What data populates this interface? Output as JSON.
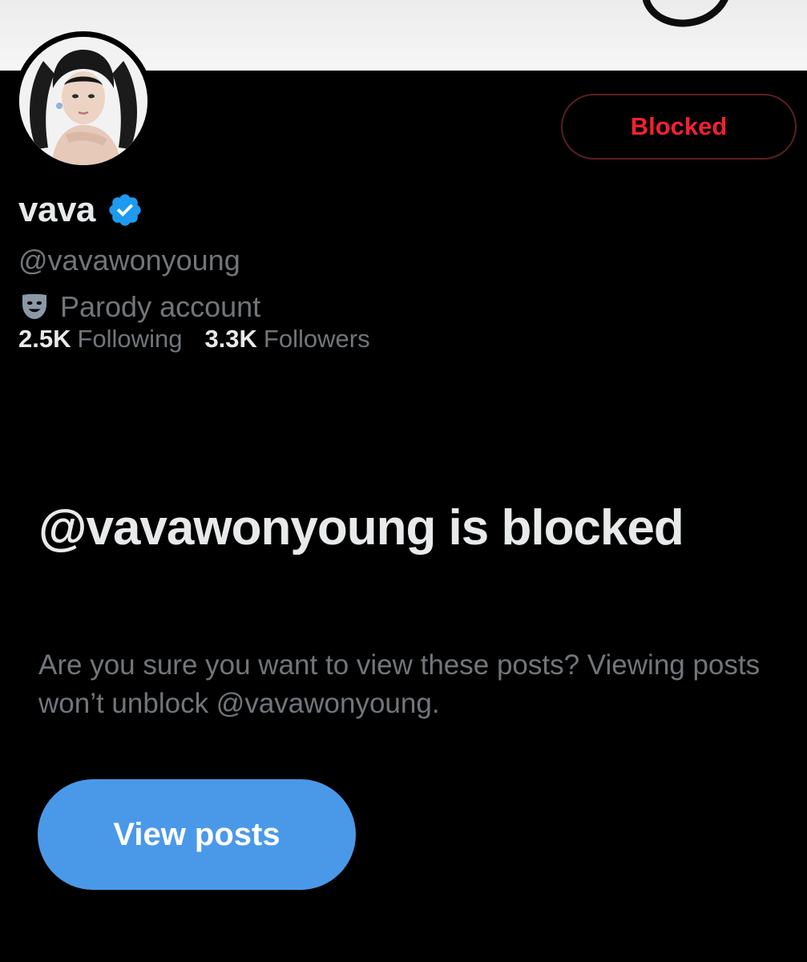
{
  "profile": {
    "display_name": "vava",
    "handle": "@vavawonyoung",
    "account_label": "Parody account",
    "following_count": "2.5K",
    "following_label": "Following",
    "followers_count": "3.3K",
    "followers_label": "Followers"
  },
  "actions": {
    "blocked_label": "Blocked",
    "view_posts_label": "View posts"
  },
  "blocked_notice": {
    "title": "@vavawonyoung is blocked",
    "description": "Are you sure you want to view these posts? Viewing posts won’t unblock @vavawonyoung."
  },
  "icons": {
    "verified": "verified-badge-icon",
    "parody": "theater-mask-icon"
  },
  "colors": {
    "background": "#000000",
    "primary_text": "#e7e9ea",
    "secondary_text": "#71767b",
    "blocked_red": "#f4212e",
    "accent_blue": "#4a99e9",
    "verified_blue": "#1d9bf0"
  }
}
